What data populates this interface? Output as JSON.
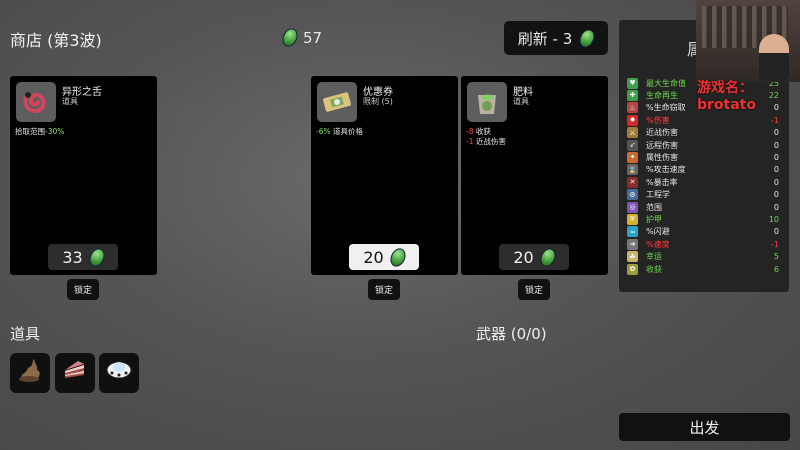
{
  "header": {
    "shop_title": "商店 (第3波)",
    "currency_icon": "green-material-icon",
    "currency_amount": "57",
    "refresh_label": "刷新 - 3"
  },
  "shop": [
    {
      "name": "异形之舌",
      "type": "道具",
      "icon": "alien-tongue-icon",
      "effects": [
        {
          "value": "拾取范围",
          "suffix": "-30%",
          "color": "#7ee35f"
        }
      ],
      "price": "33",
      "lock_label": "锁定"
    },
    {
      "name": "优惠券",
      "type": "限制 (5)",
      "icon": "coupon-icon",
      "effects": [
        {
          "value": "-6%",
          "suffix": "道具价格",
          "color": "#7ee35f"
        }
      ],
      "price": "20",
      "lock_label": "锁定",
      "price_highlight": true
    },
    {
      "name": "肥料",
      "type": "道具",
      "icon": "fertilizer-icon",
      "effects": [
        {
          "value": "-8",
          "suffix": "收获",
          "color": "#ff4040"
        },
        {
          "value": "-1",
          "suffix": "近战伤害",
          "color": "#ff4040"
        }
      ],
      "price": "20",
      "lock_label": "锁定"
    }
  ],
  "inventory": {
    "title": "道具",
    "items": [
      {
        "icon": "poop-icon"
      },
      {
        "icon": "cake-slice-icon"
      },
      {
        "icon": "ufo-icon"
      }
    ]
  },
  "weapons": {
    "title": "武器 (0/0)"
  },
  "stats_panel": {
    "title": "属",
    "rows": [
      {
        "name": "最大生命值",
        "value": "25",
        "color": "#6bd84c",
        "icon": "heart-icon",
        "icon_bg": "#3ea04a"
      },
      {
        "name": "生命再生",
        "value": "22",
        "color": "#6bd84c",
        "icon": "regen-icon",
        "icon_bg": "#3ea04a"
      },
      {
        "name": "%生命窃取",
        "value": "0",
        "color": "#e6e6e6",
        "icon": "lifesteal-icon",
        "icon_bg": "#b14646"
      },
      {
        "name": "%伤害",
        "value": "-1",
        "color": "#ff3e3e",
        "icon": "damage-icon",
        "icon_bg": "#cf2b2b"
      },
      {
        "name": "近战伤害",
        "value": "0",
        "color": "#e6e6e6",
        "icon": "melee-icon",
        "icon_bg": "#a17d3a"
      },
      {
        "name": "远程伤害",
        "value": "0",
        "color": "#e6e6e6",
        "icon": "ranged-icon",
        "icon_bg": "#555"
      },
      {
        "name": "属性伤害",
        "value": "0",
        "color": "#e6e6e6",
        "icon": "elemental-icon",
        "icon_bg": "#c96a30"
      },
      {
        "name": "%攻击速度",
        "value": "0",
        "color": "#e6e6e6",
        "icon": "attack-speed-icon",
        "icon_bg": "#666"
      },
      {
        "name": "%暴击率",
        "value": "0",
        "color": "#e6e6e6",
        "icon": "crit-icon",
        "icon_bg": "#8a2c2c"
      },
      {
        "name": "工程学",
        "value": "0",
        "color": "#e6e6e6",
        "icon": "engineering-icon",
        "icon_bg": "#4b6ba0"
      },
      {
        "name": "范围",
        "value": "0",
        "color": "#e6e6e6",
        "icon": "range-icon",
        "icon_bg": "#7f57b3"
      },
      {
        "name": "护甲",
        "value": "10",
        "color": "#6bd84c",
        "icon": "armor-icon",
        "icon_bg": "#d8b028"
      },
      {
        "name": "%闪避",
        "value": "0",
        "color": "#e6e6e6",
        "icon": "dodge-icon",
        "icon_bg": "#2ca2c8"
      },
      {
        "name": "%速度",
        "value": "-1",
        "color": "#ff3e3e",
        "icon": "speed-icon",
        "icon_bg": "#777"
      },
      {
        "name": "幸运",
        "value": "5",
        "color": "#6bd84c",
        "icon": "luck-icon",
        "icon_bg": "#c8b56a"
      },
      {
        "name": "收获",
        "value": "6",
        "color": "#6bd84c",
        "icon": "harvest-icon",
        "icon_bg": "#9d9d3a"
      }
    ]
  },
  "stream_overlay": {
    "label": "游戏名：brotato"
  },
  "footer": {
    "go_label": "出发"
  }
}
